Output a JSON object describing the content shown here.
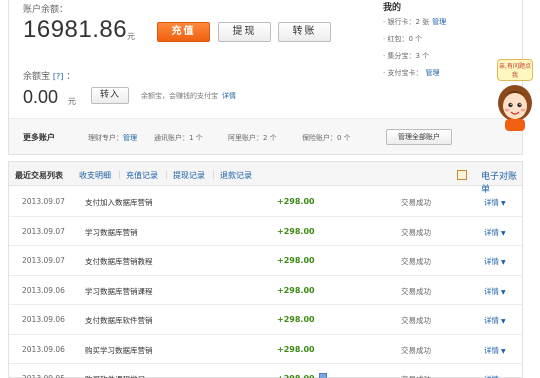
{
  "account": {
    "balance_label": "账户余额：",
    "balance_amount": "16981.86",
    "balance_unit": "元",
    "buttons": {
      "charge": "充值",
      "withdraw": "提现",
      "transfer": "转账"
    }
  },
  "yuebao": {
    "label": "余额宝",
    "help": "[?]",
    "label_suffix": "：",
    "amount": "0.00",
    "unit": "元",
    "transfer_in": "转入",
    "note": "余额宝，会赚钱的支付宝",
    "note_link": "详情"
  },
  "assets": {
    "title": "我的",
    "items": [
      {
        "prefix": "· 银行卡：2 张",
        "link": "管理"
      },
      {
        "prefix": "· 红包：0 个",
        "link": ""
      },
      {
        "prefix": "· 集分宝：3 个",
        "link": ""
      },
      {
        "prefix": "· 支付宝卡：",
        "link": "管理"
      }
    ]
  },
  "helper": {
    "bubble": "亲,有问题点我"
  },
  "more_accounts": {
    "title": "更多账户",
    "items": [
      {
        "prefix": "理财专户：",
        "link": "管理"
      },
      {
        "prefix": "通讯账户：1 个",
        "link": ""
      },
      {
        "prefix": "阿里账户：2 个",
        "link": ""
      },
      {
        "prefix": "保险账户：0 个",
        "link": ""
      }
    ],
    "manage_all": "管理全部账户"
  },
  "transactions": {
    "title": "最近交易列表",
    "tabs": [
      "收支明细",
      "充值记录",
      "提现记录",
      "退款记录"
    ],
    "ebill": "电子对账单",
    "rows": [
      {
        "date": "2013.09.07",
        "name": "支付加入数据库营销",
        "amount": "+298.00",
        "status": "交易成功",
        "detail": "详情"
      },
      {
        "date": "2013.09.07",
        "name": "学习数据库营销",
        "amount": "+298.00",
        "status": "交易成功",
        "detail": "详情"
      },
      {
        "date": "2013.09.07",
        "name": "支付数据库营销教程",
        "amount": "+298.00",
        "status": "交易成功",
        "detail": "详情"
      },
      {
        "date": "2013.09.06",
        "name": "学习数据库营销课程",
        "amount": "+298.00",
        "status": "交易成功",
        "detail": "详情"
      },
      {
        "date": "2013.09.06",
        "name": "支付数据库软件营销",
        "amount": "+298.00",
        "status": "交易成功",
        "detail": "详情"
      },
      {
        "date": "2013.09.06",
        "name": "购买学习数据库营销",
        "amount": "+298.00",
        "status": "交易成功",
        "detail": "详情"
      },
      {
        "date": "2013.09.05",
        "name": "购买软件课程学习",
        "amount": "+298.00",
        "status": "交易成功",
        "detail": "详情"
      }
    ]
  },
  "colors": {
    "accent_orange": "#f06010",
    "link_blue": "#1a5fa8",
    "income_green": "#3b8a14"
  }
}
